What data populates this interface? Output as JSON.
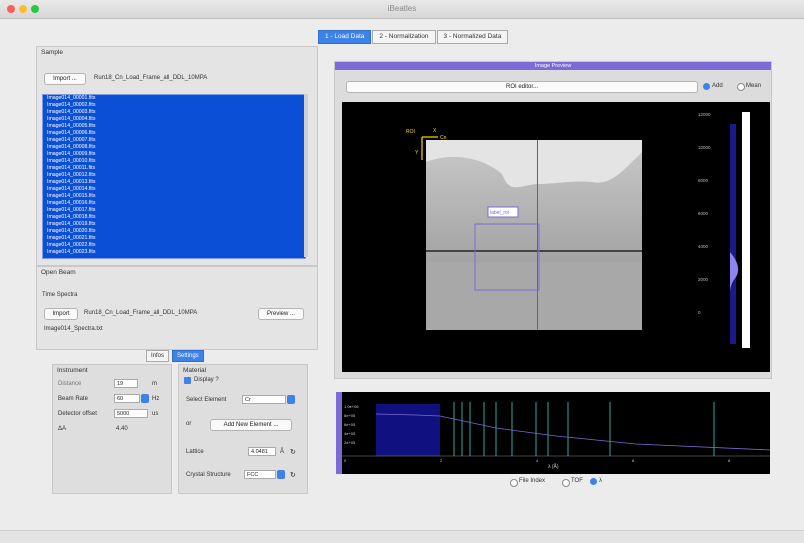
{
  "window": {
    "title": "iBeatles"
  },
  "tabs": [
    {
      "label": "1 - Load Data",
      "selected": true
    },
    {
      "label": "2 - Normalization",
      "selected": false
    },
    {
      "label": "3 - Normalized Data",
      "selected": false
    }
  ],
  "sample": {
    "title": "Sample",
    "import_label": "Import ...",
    "folder": "Run18_Cn_Load_Frame_all_DDL_10MPA",
    "files": [
      "Image014_00001.fits",
      "Image014_00002.fits",
      "Image014_00003.fits",
      "Image014_00004.fits",
      "Image014_00005.fits",
      "Image014_00006.fits",
      "Image014_00007.fits",
      "Image014_00008.fits",
      "Image014_00009.fits",
      "Image014_00010.fits",
      "Image014_00011.fits",
      "Image014_00012.fits",
      "Image014_00013.fits",
      "Image014_00014.fits",
      "Image014_00015.fits",
      "Image014_00016.fits",
      "Image014_00017.fits",
      "Image014_00018.fits",
      "Image014_00019.fits",
      "Image014_00020.fits",
      "Image014_00021.fits",
      "Image014_00022.fits",
      "Image014_00023.fits"
    ]
  },
  "open_beam": {
    "title": "Open Beam",
    "time_spectra_label": "Time Spectra",
    "import_label": "Import",
    "folder": "Run18_Cn_Load_Frame_all_DDL_10MPA",
    "preview_label": "Preview ...",
    "file": "Image014_Spectra.txt"
  },
  "subtabs": [
    {
      "label": "Infos",
      "selected": false
    },
    {
      "label": "Settings",
      "selected": true
    }
  ],
  "instrument": {
    "title": "Instrument",
    "distance_label": "Distance",
    "distance_value": "19",
    "distance_unit": "m",
    "beam_rate_label": "Beam Rate",
    "beam_rate_value": "60",
    "beam_rate_unit": "Hz",
    "detector_offset_label": "Detector offset",
    "detector_offset_value": "5000",
    "detector_offset_unit": "us",
    "delta_label": "ΔA",
    "delta_value": "4.40"
  },
  "material": {
    "title": "Material",
    "display_label": "Display ?",
    "select_element_label": "Select Element",
    "select_element_value": "Cr",
    "or_label": "or",
    "add_element_label": "Add New Element ...",
    "lattice_label": "Lattice",
    "lattice_value": "4.0481",
    "lattice_unit": "Å",
    "crystal_label": "Crystal Structure",
    "crystal_value": "FCC"
  },
  "image_preview": {
    "title": "Image Preview",
    "roi_label": "ROI editor...",
    "add_label": "Add",
    "mean_label": "Mean",
    "roi_box_label": "label_roi",
    "axis_labels": {
      "roi": "ROI",
      "x": "X",
      "y": "Y",
      "n": "Cn"
    },
    "colorbar_ticks": [
      "12000",
      "10000",
      "8000",
      "6000",
      "4000",
      "2000",
      "0"
    ]
  },
  "spectrum": {
    "x_label": "λ (Å)",
    "mode_options": [
      "File Index",
      "TOF",
      "λ"
    ],
    "selected_mode": "λ",
    "y_ticks": [
      "1.0e+06",
      "8e+05",
      "6e+05",
      "4e+05",
      "2e+05"
    ],
    "x_ticks": [
      "0",
      "2",
      "4",
      "6",
      "8"
    ]
  },
  "colors": {
    "accent": "#3d82e8",
    "list_bg": "#0b4fd6",
    "roi": "#7b6bd6",
    "bragg": "#3fd0c4"
  }
}
